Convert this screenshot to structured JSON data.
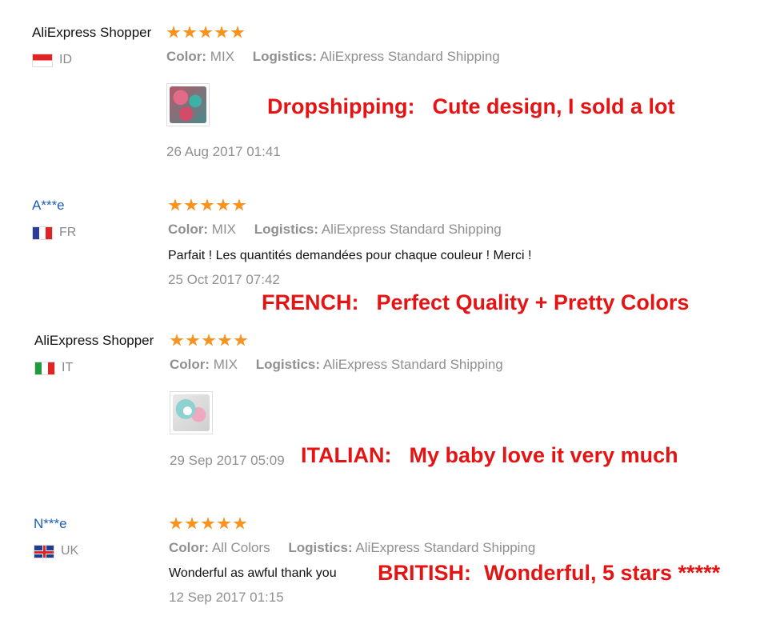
{
  "reviews": [
    {
      "user": "AliExpress Shopper",
      "country": "ID",
      "flag": "flag-indonesia-icon",
      "rating": 5,
      "color_label": "Color:",
      "color_value": "MIX",
      "logistics_label": "Logistics:",
      "logistics_value": "AliExpress Standard Shipping",
      "comment": "",
      "has_photo": true,
      "date": "26 Aug 2017 01:41",
      "note_tag": "Dropshipping:",
      "note_text": "Cute design, I sold a lot"
    },
    {
      "user": "A***e",
      "country": "FR",
      "flag": "flag-france-icon",
      "rating": 5,
      "color_label": "Color:",
      "color_value": "MIX",
      "logistics_label": "Logistics:",
      "logistics_value": "AliExpress Standard Shipping",
      "comment": "Parfait ! Les quantités demandées pour chaque couleur ! Merci !",
      "has_photo": false,
      "date": "25 Oct 2017 07:42",
      "note_tag": "FRENCH:",
      "note_text": "Perfect Quality + Pretty Colors"
    },
    {
      "user": "AliExpress Shopper",
      "country": "IT",
      "flag": "flag-italy-icon",
      "rating": 5,
      "color_label": "Color:",
      "color_value": "MIX",
      "logistics_label": "Logistics:",
      "logistics_value": "AliExpress Standard Shipping",
      "comment": "",
      "has_photo": true,
      "date": "29 Sep 2017 05:09",
      "note_tag": "ITALIAN:",
      "note_text": "My baby love it very much"
    },
    {
      "user": "N***e",
      "country": "UK",
      "flag": "flag-uk-icon",
      "rating": 5,
      "color_label": "Color:",
      "color_value": "All Colors",
      "logistics_label": "Logistics:",
      "logistics_value": "AliExpress Standard Shipping",
      "comment": "Wonderful as awful thank you",
      "has_photo": false,
      "date": "12 Sep 2017 01:15",
      "note_tag": "BRITISH:",
      "note_text": "Wonderful, 5 stars *****"
    }
  ],
  "colors": {
    "star": "#f7931e",
    "annotation": "#e51414",
    "masked_username": "#1c5fb5",
    "meta_text": "#8f8f8f"
  }
}
